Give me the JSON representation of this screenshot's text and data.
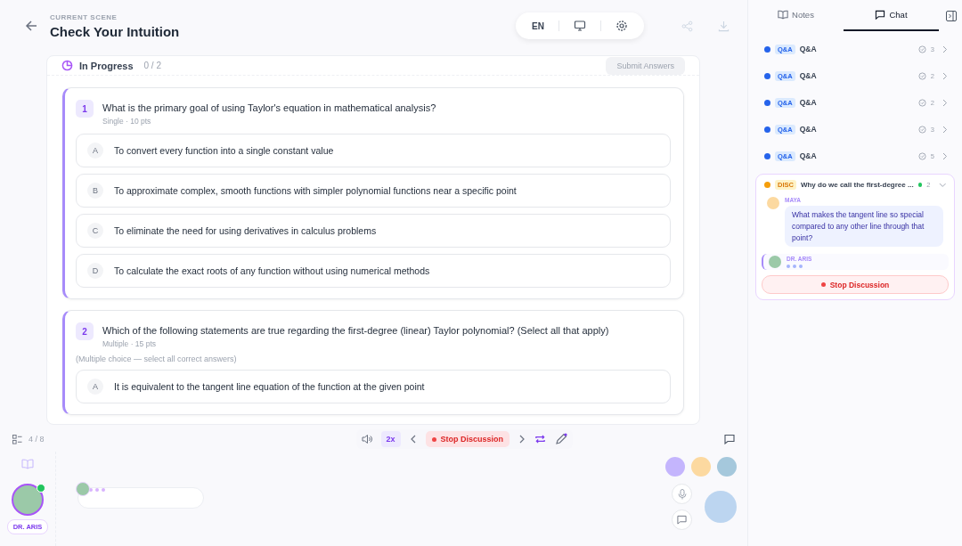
{
  "header": {
    "scene_label": "CURRENT SCENE",
    "title": "Check Your Intuition",
    "language": "EN"
  },
  "quiz": {
    "status": "In Progress",
    "progress": "0 / 2",
    "submit": "Submit Answers",
    "questions": [
      {
        "number": "1",
        "text": "What is the primary goal of using Taylor's equation in mathematical analysis?",
        "meta": "Single · 10 pts",
        "options": [
          {
            "letter": "A",
            "text": "To convert every function into a single constant value",
            "selected": false
          },
          {
            "letter": "B",
            "text": "To approximate complex, smooth functions with simpler polynomial functions near a specific point",
            "selected": false
          },
          {
            "letter": "C",
            "text": "To eliminate the need for using derivatives in calculus problems",
            "selected": false
          },
          {
            "letter": "D",
            "text": "To calculate the exact roots of any function without using numerical methods",
            "selected": false
          }
        ]
      },
      {
        "number": "2",
        "text": "Which of the following statements are true regarding the first-degree (linear) Taylor polynomial? (Select all that apply)",
        "meta": "Multiple · 15 pts",
        "hint": "(Multiple choice — select all correct answers)",
        "options": [
          {
            "letter": "A",
            "text": "It is equivalent to the tangent line equation of the function at the given point",
            "selected": false
          }
        ]
      }
    ]
  },
  "toolbar": {
    "page": "4 / 8",
    "speed": "2x",
    "stop": "Stop Discussion"
  },
  "stage": {
    "teacher": "DR. ARIS"
  },
  "sidebar": {
    "tabs": [
      {
        "label": "Notes",
        "selected": false
      },
      {
        "label": "Chat",
        "selected": true
      }
    ],
    "threads": [
      {
        "kind": "qa",
        "badge": "Q&A",
        "title": "Q&A",
        "count": "3",
        "color": "#2563eb"
      },
      {
        "kind": "qa",
        "badge": "Q&A",
        "title": "Q&A",
        "count": "2",
        "color": "#2563eb"
      },
      {
        "kind": "qa",
        "badge": "Q&A",
        "title": "Q&A",
        "count": "2",
        "color": "#2563eb"
      },
      {
        "kind": "qa",
        "badge": "Q&A",
        "title": "Q&A",
        "count": "3",
        "color": "#2563eb"
      },
      {
        "kind": "qa",
        "badge": "Q&A",
        "title": "Q&A",
        "count": "5",
        "color": "#2563eb"
      }
    ],
    "discussion": {
      "badge": "DISC",
      "title": "Why do we call the first-degree ...",
      "count": "2",
      "color": "#f59e0b",
      "expanded": true,
      "messages": [
        {
          "kind": "text",
          "author": "MAYA",
          "text": "What makes the tangent line so special compared to any other line through that point?"
        },
        {
          "kind": "typing",
          "author": "DR. ARIS"
        }
      ],
      "stop": "Stop Discussion"
    }
  }
}
